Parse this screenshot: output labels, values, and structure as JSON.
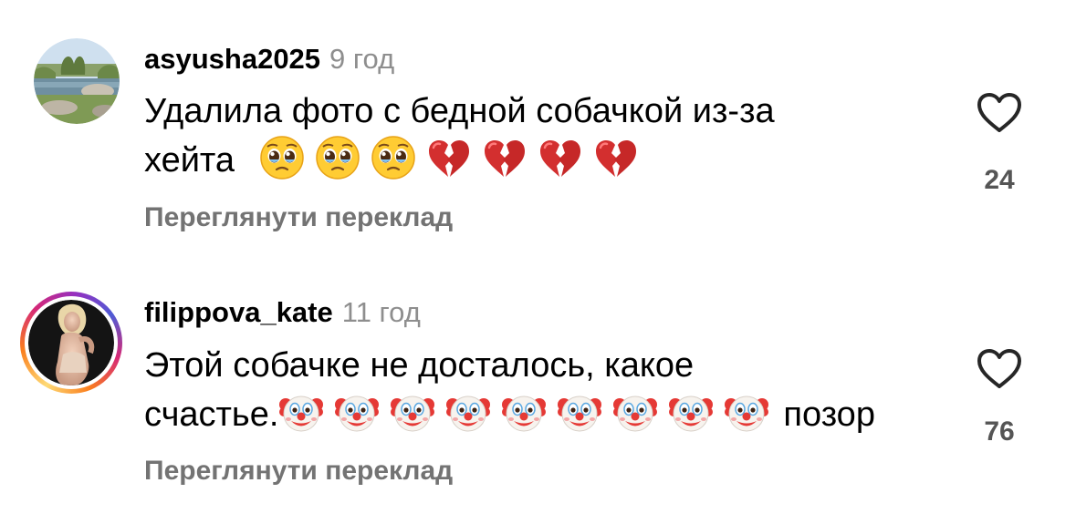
{
  "comments": [
    {
      "username": "asyusha2025",
      "time": "9 год",
      "text_line1": "Удалила фото с бедной собачкой из-за",
      "text_line2_prefix": "хейта",
      "emojis": [
        "pleading-face-emoji",
        "pleading-face-emoji",
        "pleading-face-emoji",
        "broken-heart-emoji",
        "broken-heart-emoji",
        "broken-heart-emoji",
        "broken-heart-emoji"
      ],
      "text_line2_suffix": "",
      "translate_label": "Переглянути переклад",
      "likes": "24"
    },
    {
      "username": "filippova_kate",
      "time": "11 год",
      "text_line1": "Этой собачке не досталось, какое",
      "text_line2_prefix": "счастье.",
      "emojis": [
        "clown-face-emoji",
        "clown-face-emoji",
        "clown-face-emoji",
        "clown-face-emoji",
        "clown-face-emoji",
        "clown-face-emoji",
        "clown-face-emoji",
        "clown-face-emoji",
        "clown-face-emoji"
      ],
      "text_line2_suffix": "позор",
      "translate_label": "Переглянути переклад",
      "likes": "76"
    }
  ],
  "icons": {
    "like": "heart-outline-icon"
  },
  "colors": {
    "username": "#000000",
    "secondary_text": "#8e8e8e",
    "translate_link": "#737373",
    "like_count": "#555555",
    "story_ring": [
      "#feda75",
      "#fa7e1e",
      "#d62976",
      "#962fbf",
      "#4f5bd5"
    ]
  }
}
